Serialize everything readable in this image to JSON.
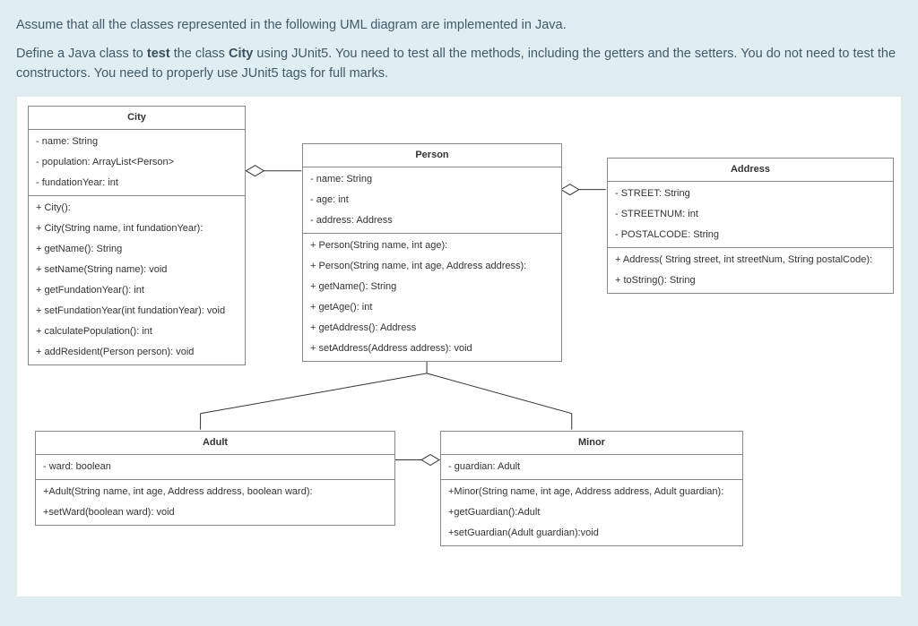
{
  "instructions": {
    "p1_pre": "Assume that all the classes represented in the following UML diagram are implemented in Java.",
    "p2_a": "Define a Java class to ",
    "p2_b_bold": "test",
    "p2_c": " the class ",
    "p2_d_bold": "City",
    "p2_e": " using JUnit5. You need to test all the methods, including the getters and the setters. You do not need to test the constructors. You need to properly use JUnit5 tags for full marks."
  },
  "classes": {
    "city": {
      "name": "City",
      "attrs": [
        "- name: String",
        "- population: ArrayList<Person>",
        "- fundationYear: int"
      ],
      "ops": [
        "+ City():",
        "+ City(String name, int fundationYear):",
        "+ getName(): String",
        "+ setName(String name): void",
        "+ getFundationYear(): int",
        "+ setFundationYear(int fundationYear): void",
        "+ calculatePopulation(): int",
        "+ addResident(Person person): void"
      ]
    },
    "person": {
      "name": "Person",
      "attrs": [
        "- name: String",
        "- age: int",
        "- address: Address"
      ],
      "ops": [
        "+ Person(String name, int age):",
        "+ Person(String name, int age, Address address):",
        "+ getName(): String",
        "+ getAge(): int",
        "+ getAddress(): Address",
        "+ setAddress(Address address): void"
      ]
    },
    "address": {
      "name": "Address",
      "attrs": [
        "- STREET: String",
        "- STREETNUM: int",
        "- POSTALCODE: String"
      ],
      "ops": [
        "+ Address( String street, int streetNum, String postalCode):",
        "+ toString(): String"
      ]
    },
    "adult": {
      "name": "Adult",
      "attrs": [
        "- ward: boolean"
      ],
      "ops": [
        "+Adult(String name, int age, Address address, boolean ward):",
        "+setWard(boolean ward): void"
      ]
    },
    "minor": {
      "name": "Minor",
      "attrs": [
        "- guardian: Adult"
      ],
      "ops": [
        "+Minor(String name, int age, Address address, Adult guardian):",
        "+getGuardian():Adult",
        "+setGuardian(Adult guardian):void"
      ]
    }
  }
}
